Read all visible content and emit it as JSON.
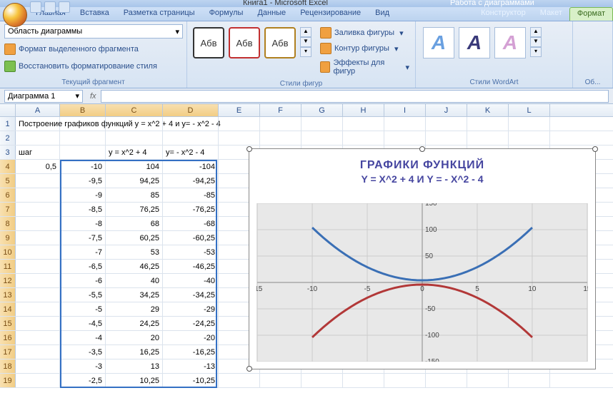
{
  "app": {
    "title": "Книга1 - Microsoft Excel",
    "context_title": "Работа с диаграммами"
  },
  "tabs": {
    "main": [
      "Главная",
      "Вставка",
      "Разметка страницы",
      "Формулы",
      "Данные",
      "Рецензирование",
      "Вид"
    ],
    "context": [
      "Конструктор",
      "Макет",
      "Формат"
    ],
    "active": "Формат"
  },
  "ribbon": {
    "selection": {
      "value": "Область диаграммы",
      "format_sel": "Формат выделенного фрагмента",
      "reset": "Восстановить форматирование стиля",
      "group": "Текущий фрагмент"
    },
    "styles": {
      "label": "Абв",
      "group": "Стили фигур",
      "fill": "Заливка фигуры",
      "outline": "Контур фигуры",
      "effects": "Эффекты для фигур"
    },
    "wordart": {
      "group": "Стили WordArt",
      "letter": "А"
    },
    "size": {
      "group": "Об..."
    }
  },
  "namebox": "Диаграмма 1",
  "sheet": {
    "columns": [
      "A",
      "B",
      "C",
      "D",
      "E",
      "F",
      "G",
      "H",
      "I",
      "J",
      "K",
      "L"
    ],
    "title_row": "Построение графиков функций y = x^2 + 4  и у= - x^2 - 4",
    "step_label": "шаг",
    "headers": {
      "c": "у = x^2 + 4",
      "d": "у= - x^2 - 4"
    },
    "rows": [
      {
        "a": "0,5",
        "b": "-10",
        "c": "104",
        "d": "-104"
      },
      {
        "a": "",
        "b": "-9,5",
        "c": "94,25",
        "d": "-94,25"
      },
      {
        "a": "",
        "b": "-9",
        "c": "85",
        "d": "-85"
      },
      {
        "a": "",
        "b": "-8,5",
        "c": "76,25",
        "d": "-76,25"
      },
      {
        "a": "",
        "b": "-8",
        "c": "68",
        "d": "-68"
      },
      {
        "a": "",
        "b": "-7,5",
        "c": "60,25",
        "d": "-60,25"
      },
      {
        "a": "",
        "b": "-7",
        "c": "53",
        "d": "-53"
      },
      {
        "a": "",
        "b": "-6,5",
        "c": "46,25",
        "d": "-46,25"
      },
      {
        "a": "",
        "b": "-6",
        "c": "40",
        "d": "-40"
      },
      {
        "a": "",
        "b": "-5,5",
        "c": "34,25",
        "d": "-34,25"
      },
      {
        "a": "",
        "b": "-5",
        "c": "29",
        "d": "-29"
      },
      {
        "a": "",
        "b": "-4,5",
        "c": "24,25",
        "d": "-24,25"
      },
      {
        "a": "",
        "b": "-4",
        "c": "20",
        "d": "-20"
      },
      {
        "a": "",
        "b": "-3,5",
        "c": "16,25",
        "d": "-16,25"
      },
      {
        "a": "",
        "b": "-3",
        "c": "13",
        "d": "-13"
      },
      {
        "a": "",
        "b": "-2,5",
        "c": "10,25",
        "d": "-10,25"
      }
    ]
  },
  "chart": {
    "title": "ГРАФИКИ ФУНКЦИЙ",
    "subtitle": "Y = X^2 + 4  И  Y = - X^2 - 4",
    "xticks": [
      "-15",
      "-10",
      "-5",
      "0",
      "5",
      "10",
      "15"
    ],
    "yticks": [
      "150",
      "100",
      "50",
      "0",
      "-50",
      "-100",
      "-150"
    ]
  },
  "chart_data": {
    "type": "line",
    "title": "ГРАФИКИ ФУНКЦИЙ Y = X^2 + 4 И Y = - X^2 - 4",
    "xlabel": "",
    "ylabel": "",
    "xlim": [
      -15,
      15
    ],
    "ylim": [
      -150,
      150
    ],
    "x": [
      -10,
      -9.5,
      -9,
      -8.5,
      -8,
      -7.5,
      -7,
      -6.5,
      -6,
      -5.5,
      -5,
      -4.5,
      -4,
      -3.5,
      -3,
      -2.5,
      -2,
      -1.5,
      -1,
      -0.5,
      0,
      0.5,
      1,
      1.5,
      2,
      2.5,
      3,
      3.5,
      4,
      4.5,
      5,
      5.5,
      6,
      6.5,
      7,
      7.5,
      8,
      8.5,
      9,
      9.5,
      10
    ],
    "series": [
      {
        "name": "y = x^2 + 4",
        "color": "#3a6fb5",
        "values": [
          104,
          94.25,
          85,
          76.25,
          68,
          60.25,
          53,
          46.25,
          40,
          34.25,
          29,
          24.25,
          20,
          16.25,
          13,
          10.25,
          8,
          6.25,
          5,
          4.25,
          4,
          4.25,
          5,
          6.25,
          8,
          10.25,
          13,
          16.25,
          20,
          24.25,
          29,
          34.25,
          40,
          46.25,
          53,
          60.25,
          68,
          76.25,
          85,
          94.25,
          104
        ]
      },
      {
        "name": "y = -x^2 - 4",
        "color": "#b23838",
        "values": [
          -104,
          -94.25,
          -85,
          -76.25,
          -68,
          -60.25,
          -53,
          -46.25,
          -40,
          -34.25,
          -29,
          -24.25,
          -20,
          -16.25,
          -13,
          -10.25,
          -8,
          -6.25,
          -5,
          -4.25,
          -4,
          -4.25,
          -5,
          -6.25,
          -8,
          -10.25,
          -13,
          -16.25,
          -20,
          -24.25,
          -29,
          -34.25,
          -40,
          -46.25,
          -53,
          -60.25,
          -68,
          -76.25,
          -85,
          -94.25,
          -104
        ]
      }
    ]
  }
}
